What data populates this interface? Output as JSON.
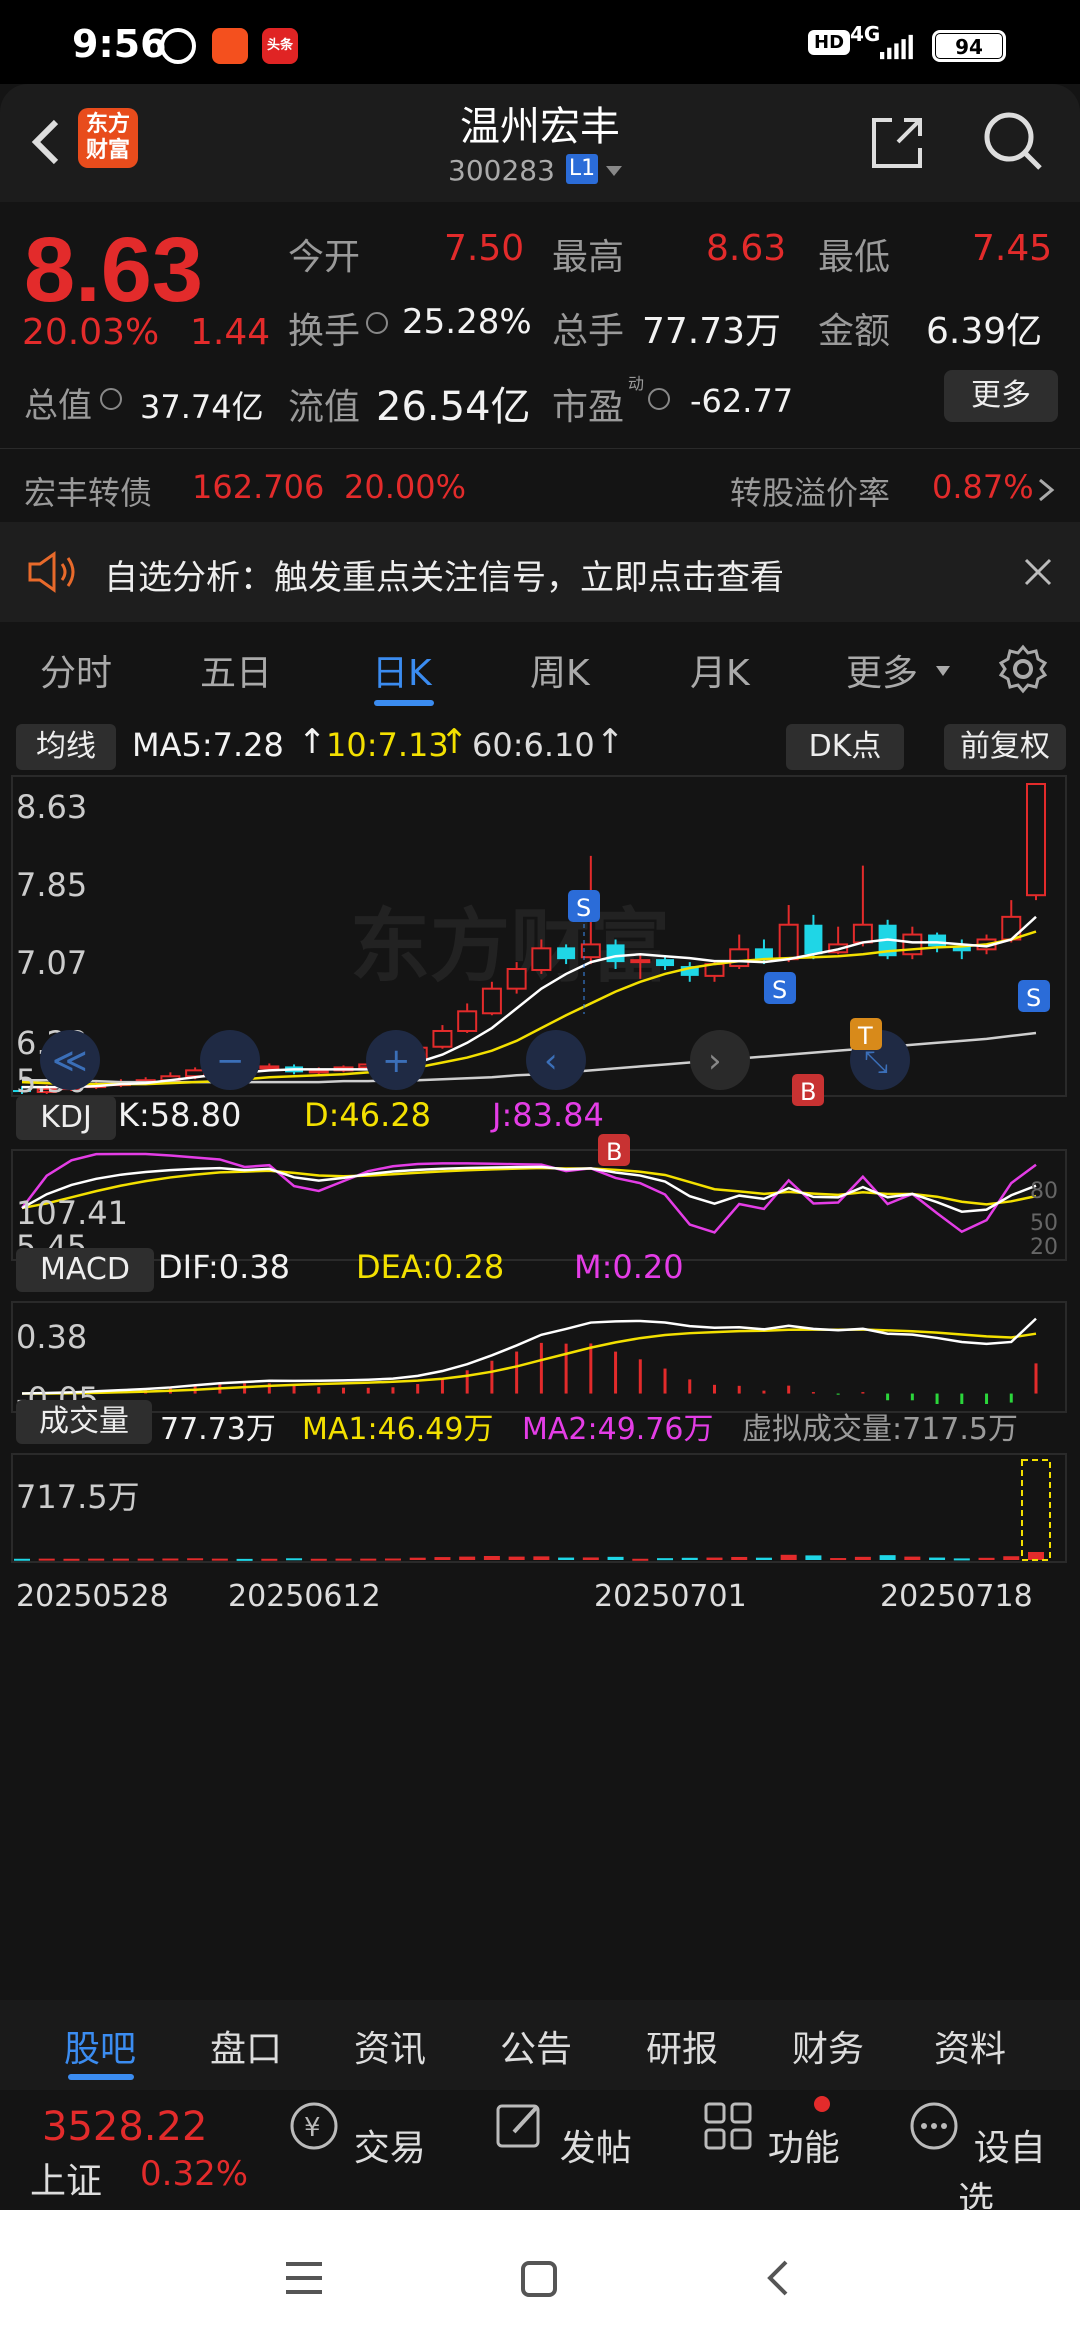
{
  "status": {
    "time": "9:56",
    "badge1": "",
    "badge2": "头条",
    "hd": "HD",
    "net": "4G",
    "battery": "94"
  },
  "header": {
    "title": "温州宏丰",
    "code": "300283",
    "level": "L1",
    "logo": "东方财富"
  },
  "quote": {
    "price": "8.63",
    "change_pct": "20.03%",
    "change_amt": "1.44",
    "open_label": "今开",
    "open": "7.50",
    "high_label": "最高",
    "high": "8.63",
    "low_label": "最低",
    "low": "7.45",
    "turnover_label": "换手",
    "turnover": "25.28%",
    "volume_label": "总手",
    "volume": "77.73万",
    "amount_label": "金额",
    "amount": "6.39亿",
    "mcap_label": "总值",
    "mcap": "37.74亿",
    "float_label": "流值",
    "float": "26.54亿",
    "pe_label": "市盈",
    "pe_sup": "动",
    "pe": "-62.77",
    "more": "更多",
    "bond_label": "宏丰转债",
    "bond_price": "162.706",
    "bond_pct": "20.00%",
    "premium_label": "转股溢价率",
    "premium": "0.87%"
  },
  "notice": {
    "text": "自选分析：触发重点关注信号，立即点击查看"
  },
  "ktabs": [
    "分时",
    "五日",
    "日K",
    "周K",
    "月K",
    "更多"
  ],
  "chart": {
    "ma_chip": "均线",
    "ma5": "MA5:7.28",
    "ma10": "10:7.13",
    "ma60": "60:6.10",
    "dk": "DK点",
    "adj": "前复权",
    "watermark": "东方财富",
    "price_ticks": [
      "8.63",
      "7.85",
      "7.07",
      "6.28",
      "5.50"
    ],
    "kdj_chip": "KDJ",
    "k": "K:58.80",
    "d": "D:46.28",
    "j": "J:83.84",
    "kdj_ticks": [
      "107.41",
      "5.45"
    ],
    "kdj_levels": [
      "80",
      "50",
      "20"
    ],
    "macd_chip": "MACD",
    "dif": "DIF:0.38",
    "dea": "DEA:0.28",
    "m": "M:0.20",
    "macd_ticks": [
      "0.38",
      "-0.05"
    ],
    "vol_chip": "成交量",
    "vol": "77.73万",
    "ma1": "MA1:46.49万",
    "ma2": "MA2:49.76万",
    "vvol": "虚拟成交量:717.5万",
    "vol_tick": "717.5万",
    "dates": [
      "20250528",
      "20250612",
      "20250701",
      "20250718"
    ],
    "signals": [
      "S",
      "B",
      "S",
      "B",
      "T",
      "S"
    ]
  },
  "chart_data": {
    "type": "candlestick",
    "ylim": [
      5.5,
      8.63
    ],
    "candles": [
      [
        5.52,
        5.5,
        5.56,
        5.48
      ],
      [
        5.5,
        5.53,
        5.57,
        5.48
      ],
      [
        5.53,
        5.55,
        5.58,
        5.51
      ],
      [
        5.55,
        5.58,
        5.62,
        5.53
      ],
      [
        5.57,
        5.6,
        5.63,
        5.55
      ],
      [
        5.59,
        5.62,
        5.65,
        5.57
      ],
      [
        5.62,
        5.66,
        5.7,
        5.6
      ],
      [
        5.66,
        5.72,
        5.75,
        5.63
      ],
      [
        5.72,
        5.75,
        5.8,
        5.7
      ],
      [
        5.74,
        5.73,
        5.78,
        5.7
      ],
      [
        5.74,
        5.76,
        5.79,
        5.72
      ],
      [
        5.76,
        5.7,
        5.78,
        5.68
      ],
      [
        5.7,
        5.72,
        5.75,
        5.68
      ],
      [
        5.72,
        5.75,
        5.77,
        5.7
      ],
      [
        5.75,
        5.78,
        5.82,
        5.72
      ],
      [
        5.78,
        5.82,
        5.85,
        5.75
      ],
      [
        5.84,
        5.95,
        6.0,
        5.8
      ],
      [
        5.96,
        6.12,
        6.18,
        5.94
      ],
      [
        6.12,
        6.32,
        6.4,
        6.1
      ],
      [
        6.3,
        6.55,
        6.62,
        6.28
      ],
      [
        6.55,
        6.75,
        6.82,
        6.5
      ],
      [
        6.74,
        6.96,
        7.05,
        6.7
      ],
      [
        6.97,
        6.85,
        7.0,
        6.8
      ],
      [
        6.87,
        7.0,
        7.9,
        6.8
      ],
      [
        7.0,
        6.82,
        7.05,
        6.75
      ],
      [
        6.82,
        6.84,
        6.9,
        6.65
      ],
      [
        6.85,
        6.78,
        6.88,
        6.74
      ],
      [
        6.78,
        6.68,
        6.82,
        6.62
      ],
      [
        6.68,
        6.8,
        6.84,
        6.62
      ],
      [
        6.78,
        6.95,
        7.1,
        6.75
      ],
      [
        6.96,
        6.85,
        7.05,
        6.8
      ],
      [
        6.85,
        7.2,
        7.4,
        6.82
      ],
      [
        7.2,
        6.9,
        7.3,
        6.85
      ],
      [
        6.92,
        7.0,
        7.18,
        6.9
      ],
      [
        7.02,
        7.2,
        7.8,
        6.98
      ],
      [
        7.2,
        6.88,
        7.25,
        6.85
      ],
      [
        6.9,
        7.1,
        7.18,
        6.85
      ],
      [
        7.1,
        6.98,
        7.12,
        6.92
      ],
      [
        6.98,
        6.93,
        7.05,
        6.85
      ],
      [
        6.95,
        7.05,
        7.1,
        6.9
      ],
      [
        7.05,
        7.28,
        7.45,
        7.02
      ],
      [
        7.5,
        8.63,
        8.63,
        7.45
      ]
    ],
    "ma5": [
      5.55,
      5.55,
      5.55,
      5.56,
      5.58,
      5.59,
      5.62,
      5.65,
      5.68,
      5.7,
      5.72,
      5.73,
      5.73,
      5.73,
      5.73,
      5.76,
      5.8,
      5.88,
      6.0,
      6.15,
      6.35,
      6.55,
      6.7,
      6.82,
      6.88,
      6.9,
      6.88,
      6.86,
      6.83,
      6.83,
      6.82,
      6.85,
      6.9,
      6.95,
      7.02,
      7.05,
      7.02,
      7.02,
      7.0,
      6.98,
      7.05,
      7.28
    ],
    "ma10": [
      5.6,
      5.59,
      5.58,
      5.58,
      5.58,
      5.58,
      5.59,
      5.6,
      5.61,
      5.63,
      5.65,
      5.66,
      5.67,
      5.68,
      5.7,
      5.72,
      5.75,
      5.8,
      5.85,
      5.92,
      6.02,
      6.15,
      6.28,
      6.4,
      6.52,
      6.62,
      6.7,
      6.76,
      6.8,
      6.83,
      6.85,
      6.86,
      6.87,
      6.88,
      6.9,
      6.93,
      6.95,
      6.97,
      6.98,
      7.0,
      7.05,
      7.13
    ],
    "ma60": [
      5.62,
      5.62,
      5.61,
      5.61,
      5.6,
      5.6,
      5.6,
      5.6,
      5.6,
      5.6,
      5.6,
      5.6,
      5.6,
      5.61,
      5.61,
      5.62,
      5.62,
      5.63,
      5.64,
      5.65,
      5.67,
      5.68,
      5.7,
      5.72,
      5.74,
      5.76,
      5.78,
      5.8,
      5.82,
      5.84,
      5.86,
      5.88,
      5.9,
      5.92,
      5.94,
      5.96,
      5.98,
      6.0,
      6.02,
      6.04,
      6.07,
      6.1
    ]
  }
}
